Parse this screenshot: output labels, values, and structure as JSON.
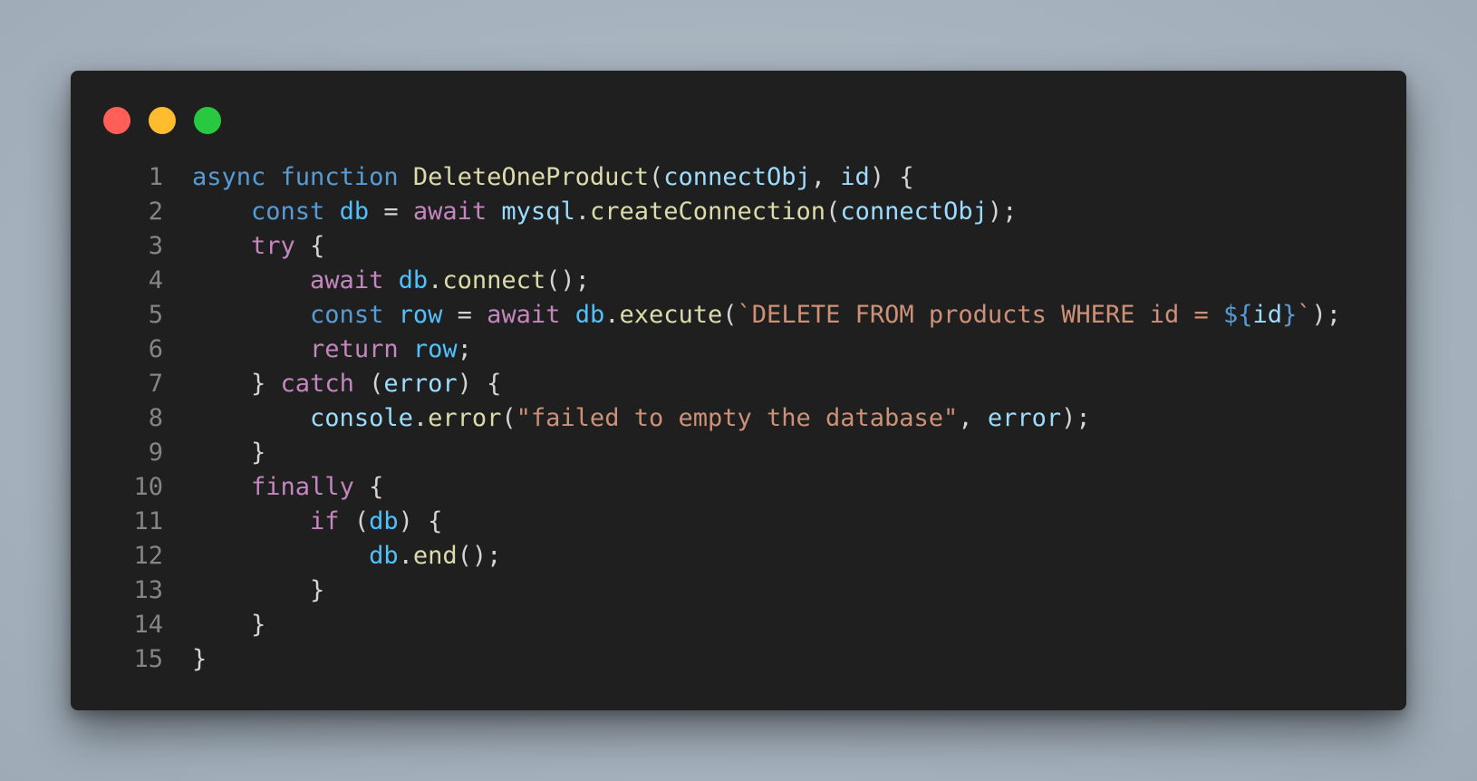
{
  "window": {
    "controls": [
      "close",
      "minimize",
      "maximize"
    ]
  },
  "colors": {
    "keyword": "#569cd6",
    "control": "#c586c0",
    "function": "#dcdcaa",
    "param": "#9cdcfe",
    "variable": "#4fc1ff",
    "string": "#ce9178",
    "punct": "#d4d4d4",
    "line_number": "#858585",
    "editor_background": "#1f1f1f"
  },
  "code": {
    "lines": [
      {
        "number": "1",
        "tokens": [
          {
            "t": "async",
            "c": "keyword"
          },
          {
            "t": " ",
            "c": "punct"
          },
          {
            "t": "function",
            "c": "keyword"
          },
          {
            "t": " ",
            "c": "punct"
          },
          {
            "t": "DeleteOneProduct",
            "c": "function"
          },
          {
            "t": "(",
            "c": "punct"
          },
          {
            "t": "connectObj",
            "c": "param"
          },
          {
            "t": ", ",
            "c": "punct"
          },
          {
            "t": "id",
            "c": "param"
          },
          {
            "t": ") {",
            "c": "punct"
          }
        ]
      },
      {
        "number": "2",
        "tokens": [
          {
            "t": "    ",
            "c": "punct"
          },
          {
            "t": "const",
            "c": "keyword"
          },
          {
            "t": " ",
            "c": "punct"
          },
          {
            "t": "db",
            "c": "variable"
          },
          {
            "t": " = ",
            "c": "punct"
          },
          {
            "t": "await",
            "c": "control"
          },
          {
            "t": " ",
            "c": "punct"
          },
          {
            "t": "mysql",
            "c": "param"
          },
          {
            "t": ".",
            "c": "punct"
          },
          {
            "t": "createConnection",
            "c": "function"
          },
          {
            "t": "(",
            "c": "punct"
          },
          {
            "t": "connectObj",
            "c": "param"
          },
          {
            "t": ");",
            "c": "punct"
          }
        ]
      },
      {
        "number": "3",
        "tokens": [
          {
            "t": "    ",
            "c": "punct"
          },
          {
            "t": "try",
            "c": "control"
          },
          {
            "t": " {",
            "c": "punct"
          }
        ]
      },
      {
        "number": "4",
        "tokens": [
          {
            "t": "        ",
            "c": "punct"
          },
          {
            "t": "await",
            "c": "control"
          },
          {
            "t": " ",
            "c": "punct"
          },
          {
            "t": "db",
            "c": "variable"
          },
          {
            "t": ".",
            "c": "punct"
          },
          {
            "t": "connect",
            "c": "function"
          },
          {
            "t": "();",
            "c": "punct"
          }
        ]
      },
      {
        "number": "5",
        "tokens": [
          {
            "t": "        ",
            "c": "punct"
          },
          {
            "t": "const",
            "c": "keyword"
          },
          {
            "t": " ",
            "c": "punct"
          },
          {
            "t": "row",
            "c": "variable"
          },
          {
            "t": " = ",
            "c": "punct"
          },
          {
            "t": "await",
            "c": "control"
          },
          {
            "t": " ",
            "c": "punct"
          },
          {
            "t": "db",
            "c": "variable"
          },
          {
            "t": ".",
            "c": "punct"
          },
          {
            "t": "execute",
            "c": "function"
          },
          {
            "t": "(",
            "c": "punct"
          },
          {
            "t": "`DELETE FROM products WHERE id = ",
            "c": "string"
          },
          {
            "t": "${",
            "c": "templ"
          },
          {
            "t": "id",
            "c": "param"
          },
          {
            "t": "}",
            "c": "templ"
          },
          {
            "t": "`",
            "c": "string"
          },
          {
            "t": ");",
            "c": "punct"
          }
        ]
      },
      {
        "number": "6",
        "tokens": [
          {
            "t": "        ",
            "c": "punct"
          },
          {
            "t": "return",
            "c": "control"
          },
          {
            "t": " ",
            "c": "punct"
          },
          {
            "t": "row",
            "c": "variable"
          },
          {
            "t": ";",
            "c": "punct"
          }
        ]
      },
      {
        "number": "7",
        "tokens": [
          {
            "t": "    } ",
            "c": "punct"
          },
          {
            "t": "catch",
            "c": "control"
          },
          {
            "t": " (",
            "c": "punct"
          },
          {
            "t": "error",
            "c": "param"
          },
          {
            "t": ") {",
            "c": "punct"
          }
        ]
      },
      {
        "number": "8",
        "tokens": [
          {
            "t": "        ",
            "c": "punct"
          },
          {
            "t": "console",
            "c": "param"
          },
          {
            "t": ".",
            "c": "punct"
          },
          {
            "t": "error",
            "c": "function"
          },
          {
            "t": "(",
            "c": "punct"
          },
          {
            "t": "\"failed to empty the database\"",
            "c": "string"
          },
          {
            "t": ", ",
            "c": "punct"
          },
          {
            "t": "error",
            "c": "param"
          },
          {
            "t": ");",
            "c": "punct"
          }
        ]
      },
      {
        "number": "9",
        "tokens": [
          {
            "t": "    }",
            "c": "punct"
          }
        ]
      },
      {
        "number": "10",
        "tokens": [
          {
            "t": "    ",
            "c": "punct"
          },
          {
            "t": "finally",
            "c": "control"
          },
          {
            "t": " {",
            "c": "punct"
          }
        ]
      },
      {
        "number": "11",
        "tokens": [
          {
            "t": "        ",
            "c": "punct"
          },
          {
            "t": "if",
            "c": "control"
          },
          {
            "t": " (",
            "c": "punct"
          },
          {
            "t": "db",
            "c": "variable"
          },
          {
            "t": ") {",
            "c": "punct"
          }
        ]
      },
      {
        "number": "12",
        "tokens": [
          {
            "t": "            ",
            "c": "punct"
          },
          {
            "t": "db",
            "c": "variable"
          },
          {
            "t": ".",
            "c": "punct"
          },
          {
            "t": "end",
            "c": "function"
          },
          {
            "t": "();",
            "c": "punct"
          }
        ]
      },
      {
        "number": "13",
        "tokens": [
          {
            "t": "        }",
            "c": "punct"
          }
        ]
      },
      {
        "number": "14",
        "tokens": [
          {
            "t": "    }",
            "c": "punct"
          }
        ]
      },
      {
        "number": "15",
        "tokens": [
          {
            "t": "}",
            "c": "punct"
          }
        ]
      }
    ]
  }
}
